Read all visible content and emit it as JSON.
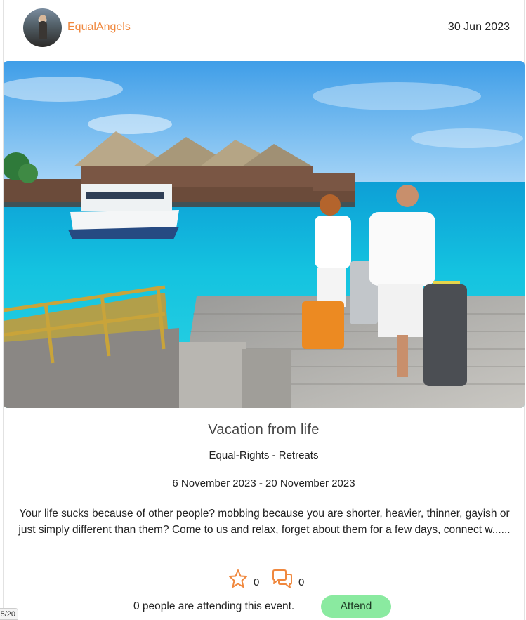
{
  "post": {
    "username": "EqualAngels",
    "date": "30 Jun 2023",
    "title": "Vacation from life",
    "category": "Equal-Rights - Retreats",
    "date_range": "6 November 2023 - 20 November 2023",
    "description": "Your life sucks because of other people? mobbing because you are shorter, heavier, thinner, gayish or just simply different than them? Come to us and relax, forget about them for a few days, connect w......",
    "likes": "0",
    "comments": "0",
    "attending_text": "0 people are attending this event.",
    "attend_label": "Attend"
  },
  "pager": {
    "label": "5/20"
  },
  "icons": {
    "star": "star-outline-icon",
    "comment": "comment-bubbles-icon"
  },
  "colors": {
    "accent": "#f0883e",
    "attend_button": "#8aeaa0"
  }
}
